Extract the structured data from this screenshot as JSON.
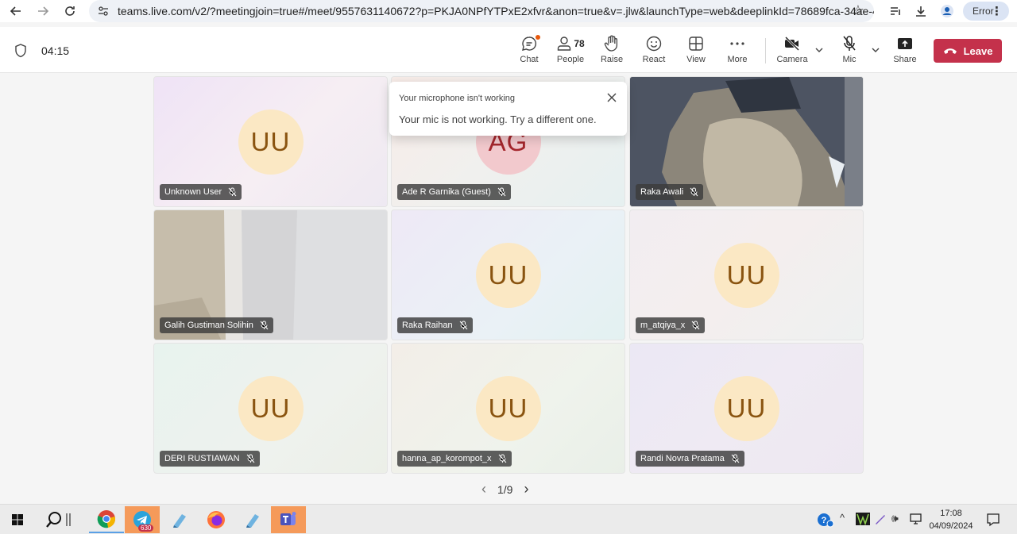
{
  "browser": {
    "url": "teams.live.com/v2/?meetingjoin=true#/meet/9557631140672?p=PKJA0NPfYTPxE2xfvr&anon=true&v=.jlw&launchType=web&deeplinkId=78689fca-34ae-4...",
    "profile_label": "Error"
  },
  "header": {
    "timer": "04:15",
    "tools": {
      "chat": "Chat",
      "people": "People",
      "people_count": "78",
      "raise": "Raise",
      "react": "React",
      "view": "View",
      "more": "More",
      "camera": "Camera",
      "mic": "Mic",
      "share": "Share"
    },
    "leave": "Leave"
  },
  "toast": {
    "title": "Your microphone isn't working",
    "message": "Your mic is not working. Try a different one."
  },
  "participants": [
    {
      "name": "Unknown User",
      "initials": "UU"
    },
    {
      "name": "Ade R Garnika (Guest)",
      "initials": "AG"
    },
    {
      "name": "Raka Awali",
      "initials": ""
    },
    {
      "name": "Galih Gustiman Solihin",
      "initials": ""
    },
    {
      "name": "Raka Raihan",
      "initials": "UU"
    },
    {
      "name": "m_atqiya_x",
      "initials": "UU"
    },
    {
      "name": "DERI RUSTIAWAN",
      "initials": "UU"
    },
    {
      "name": "hanna_ap_korompot_x",
      "initials": "UU"
    },
    {
      "name": "Randi Novra Pratama",
      "initials": "UU"
    }
  ],
  "pager": {
    "label": "1/9"
  },
  "taskbar": {
    "telegram_badge": "630",
    "time": "17:08",
    "date": "04/09/2024"
  }
}
